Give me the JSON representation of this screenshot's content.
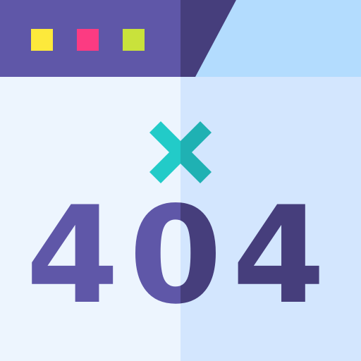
{
  "window": {
    "title_bar_color_left": "#5f57a8",
    "title_bar_color_right": "#463e7c",
    "tab_area_color": "#b3dcfe",
    "body_color_left": "#edf5fe",
    "body_color_right": "#d3e6fe",
    "control_dots": [
      {
        "name": "yellow",
        "color": "#fde93b"
      },
      {
        "name": "pink",
        "color": "#fc3b82"
      },
      {
        "name": "lime",
        "color": "#c9e23b"
      }
    ]
  },
  "error": {
    "icon": "close-x-icon",
    "icon_color_left": "#22cbc8",
    "icon_color_right": "#1fb1b3",
    "code": "404",
    "code_color_left": "#5f57a8",
    "code_color_right": "#463e7c"
  }
}
